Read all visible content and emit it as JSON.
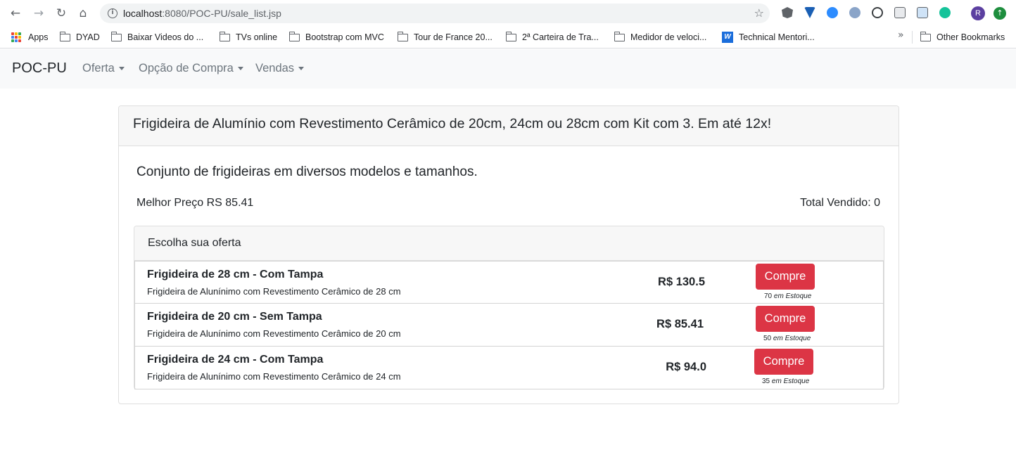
{
  "browser": {
    "url_host": "localhost",
    "url_path": ":8080/POC-PU/sale_list.jsp",
    "avatar_letter": "R",
    "bookmarks": [
      {
        "label": "Apps",
        "icon": "apps-grid-icon"
      },
      {
        "label": "DYAD",
        "icon": "folder-icon"
      },
      {
        "label": "Baixar Videos do ...",
        "icon": "folder-icon"
      },
      {
        "label": "TVs online",
        "icon": "folder-icon"
      },
      {
        "label": "Bootstrap com MVC",
        "icon": "folder-icon"
      },
      {
        "label": "Tour de France 20...",
        "icon": "folder-icon"
      },
      {
        "label": "2ª Carteira de Tra...",
        "icon": "folder-icon"
      },
      {
        "label": "Medidor de veloci...",
        "icon": "folder-icon"
      },
      {
        "label": "Technical Mentori...",
        "icon": "site-icon"
      }
    ],
    "other_bookmarks": "Other Bookmarks"
  },
  "navbar": {
    "brand": "POC-PU",
    "items": [
      {
        "label": "Oferta"
      },
      {
        "label": "Opção de Compra"
      },
      {
        "label": "Vendas"
      }
    ]
  },
  "sale": {
    "title": "Frigideira de Alumínio com Revestimento Cerâmico de 20cm, 24cm ou 28cm com Kit com 3. Em até 12x!",
    "subtitle": "Conjunto de frigideiras em diversos modelos e tamanhos.",
    "best_price": "Melhor Preço RS 85.41",
    "total_sold": "Total Vendido: 0",
    "offers_header": "Escolha sua oferta",
    "buy_label": "Compre",
    "stock_suffix": "em Estoque",
    "offers": [
      {
        "name": "Frigideira de 28 cm - Com Tampa",
        "description": "Frigideira de Alunínimo com Revestimento Cerâmico de 28 cm",
        "price": "R$ 130.5",
        "stock": "70"
      },
      {
        "name": "Frigideira de 20 cm - Sem Tampa",
        "description": "Frigideira de Alunínimo com Revestimento Cerâmico de 20 cm",
        "price": "R$ 85.41",
        "stock": "50"
      },
      {
        "name": "Frigideira de 24 cm - Com Tampa",
        "description": "Frigideira de Alunínimo com Revestimento Cerâmico de 24 cm",
        "price": "R$ 94.0",
        "stock": "35"
      }
    ]
  },
  "colors": {
    "buy_button": "#dc3545",
    "navbar_bg": "#f8f9fa"
  }
}
